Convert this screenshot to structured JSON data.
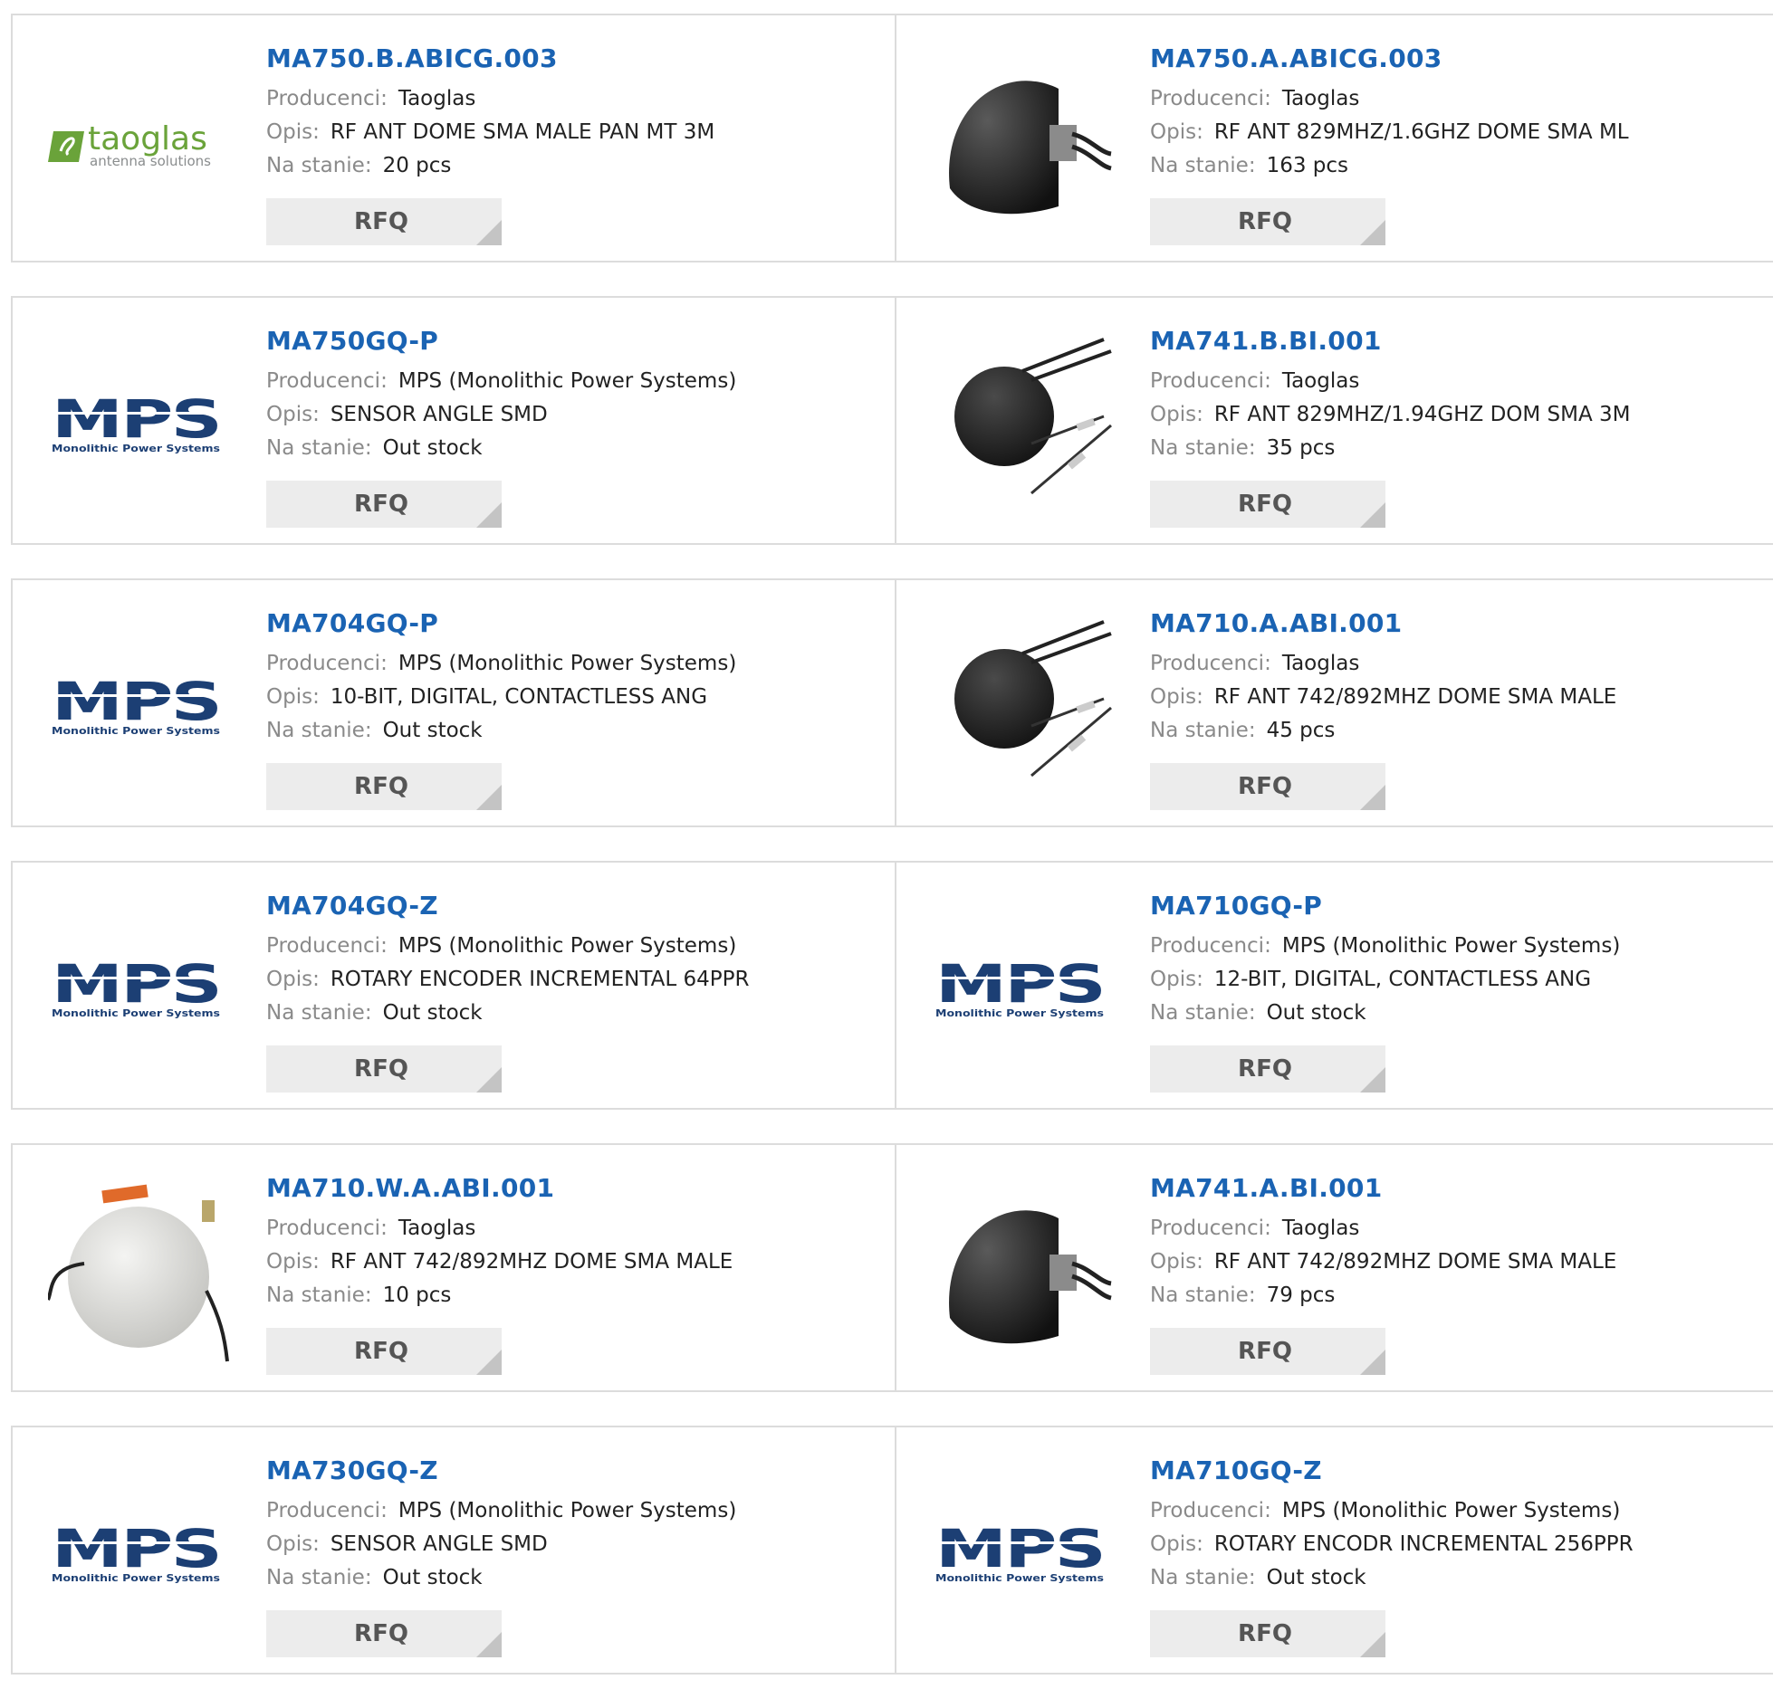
{
  "labels": {
    "manufacturer": "Producenci:",
    "description": "Opis:",
    "stock": "Na stanie:",
    "rfq": "RFQ"
  },
  "products": [
    {
      "part": "MA750.B.ABICG.003",
      "manufacturer": "Taoglas",
      "description": "RF ANT DOME SMA MALE PAN MT 3M",
      "stock": "20 pcs",
      "image": "taoglas-logo"
    },
    {
      "part": "MA750.A.ABICG.003",
      "manufacturer": "Taoglas",
      "description": "RF ANT 829MHZ/1.6GHZ DOME SMA ML",
      "stock": "163 pcs",
      "image": "black-dome-antenna"
    },
    {
      "part": "MA750GQ-P",
      "manufacturer": "MPS (Monolithic Power Systems)",
      "description": "SENSOR ANGLE SMD",
      "stock": "Out stock",
      "image": "mps-logo"
    },
    {
      "part": "MA741.B.BI.001",
      "manufacturer": "Taoglas",
      "description": "RF ANT 829MHZ/1.94GHZ DOM SMA 3M",
      "stock": "35 pcs",
      "image": "black-ball-antenna"
    },
    {
      "part": "MA704GQ-P",
      "manufacturer": "MPS (Monolithic Power Systems)",
      "description": "10-BIT, DIGITAL, CONTACTLESS ANG",
      "stock": "Out stock",
      "image": "mps-logo"
    },
    {
      "part": "MA710.A.ABI.001",
      "manufacturer": "Taoglas",
      "description": "RF ANT 742/892MHZ DOME SMA MALE",
      "stock": "45 pcs",
      "image": "black-ball-antenna"
    },
    {
      "part": "MA704GQ-Z",
      "manufacturer": "MPS (Monolithic Power Systems)",
      "description": "ROTARY ENCODER INCREMENTAL 64PPR",
      "stock": "Out stock",
      "image": "mps-logo"
    },
    {
      "part": "MA710GQ-P",
      "manufacturer": "MPS (Monolithic Power Systems)",
      "description": "12-BIT, DIGITAL, CONTACTLESS ANG",
      "stock": "Out stock",
      "image": "mps-logo"
    },
    {
      "part": "MA710.W.A.ABI.001",
      "manufacturer": "Taoglas",
      "description": "RF ANT 742/892MHZ DOME SMA MALE",
      "stock": "10 pcs",
      "image": "white-ball-antenna"
    },
    {
      "part": "MA741.A.BI.001",
      "manufacturer": "Taoglas",
      "description": "RF ANT 742/892MHZ DOME SMA MALE",
      "stock": "79 pcs",
      "image": "black-dome-antenna"
    },
    {
      "part": "MA730GQ-Z",
      "manufacturer": "MPS (Monolithic Power Systems)",
      "description": "SENSOR ANGLE SMD",
      "stock": "Out stock",
      "image": "mps-logo"
    },
    {
      "part": "MA710GQ-Z",
      "manufacturer": "MPS (Monolithic Power Systems)",
      "description": "ROTARY ENCODR INCREMENTAL 256PPR",
      "stock": "Out stock",
      "image": "mps-logo"
    }
  ],
  "logos": {
    "taoglas": {
      "name": "taoglas",
      "tagline": "antenna solutions"
    },
    "mps": {
      "name": "MPS",
      "tagline": "Monolithic Power Systems"
    }
  },
  "colors": {
    "link": "#1a63b3",
    "label": "#8a8a8a",
    "button_bg": "#ececec",
    "border": "#dcdcdc",
    "taoglas_green": "#6aa33a",
    "taoglas_grey": "#8a8d8e",
    "mps_navy": "#1c3f74"
  }
}
